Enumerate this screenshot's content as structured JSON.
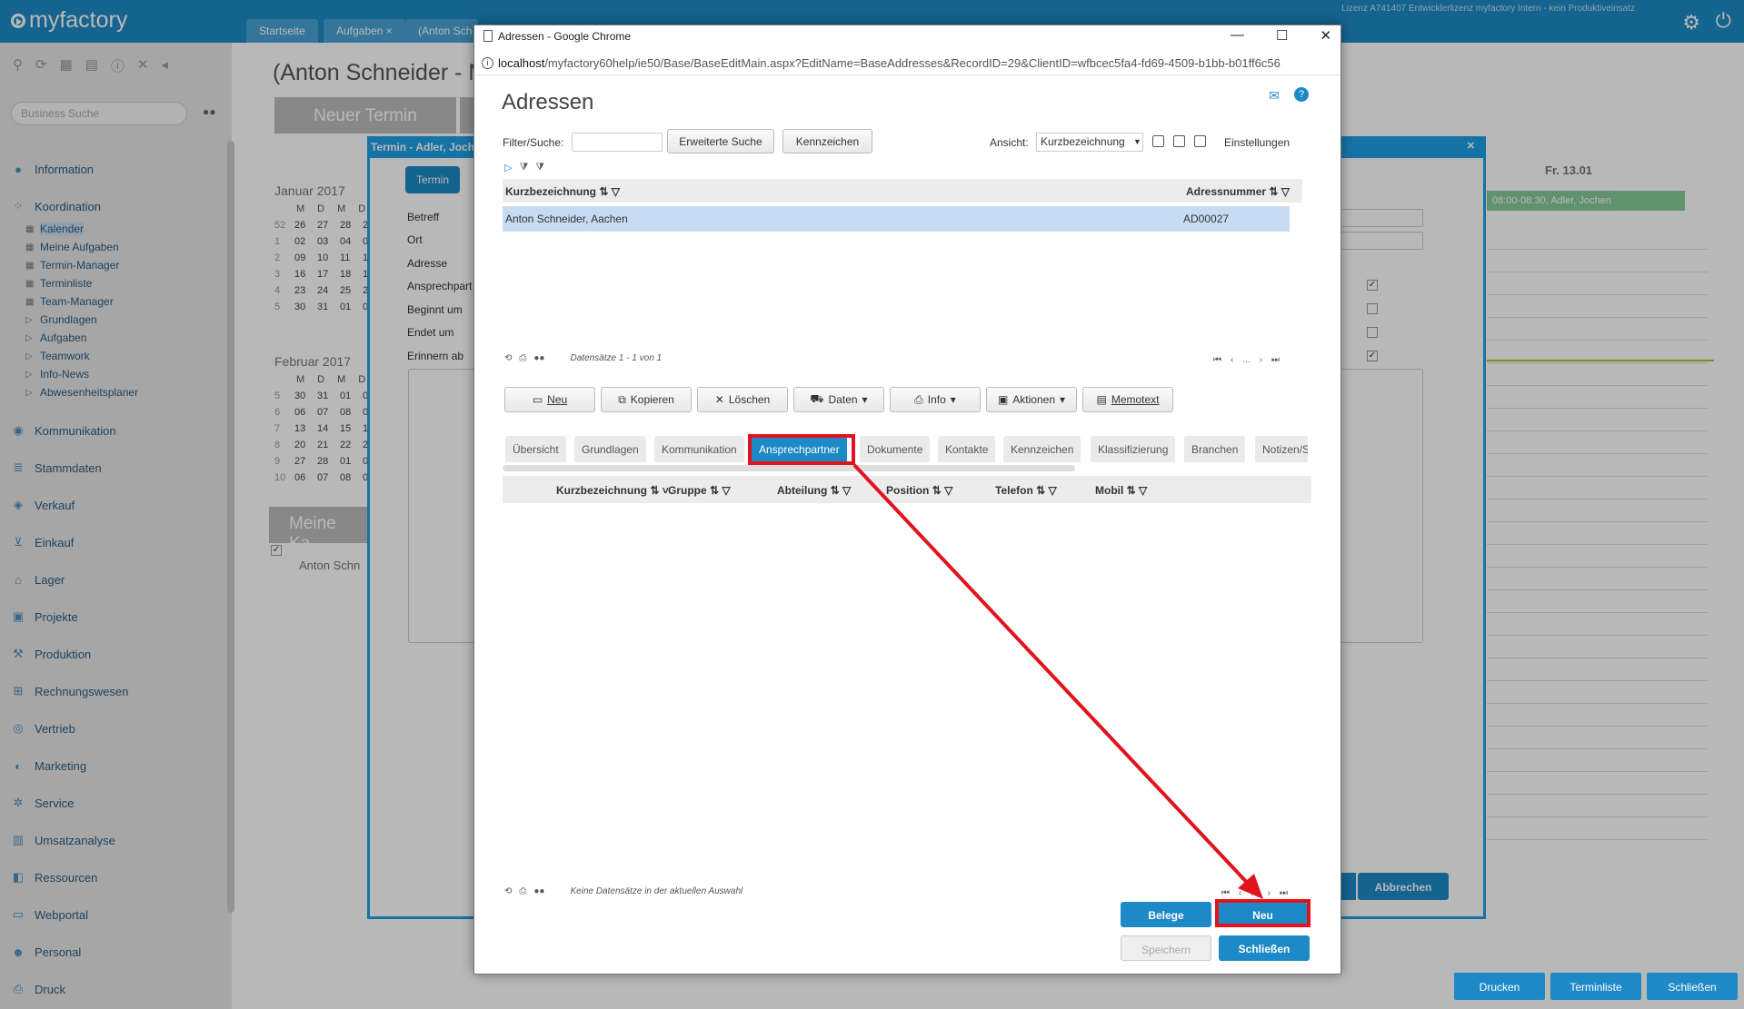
{
  "app": {
    "logo": "myfactory",
    "license": "Lizenz A741407 Entwicklerlizenz myfactory Intern - kein Produktiveinsatz",
    "tabs": [
      "Startseite",
      "Aufgaben",
      "(Anton Sch"
    ],
    "tab_close": "×"
  },
  "sidebar": {
    "search_placeholder": "Business Suche",
    "items": [
      {
        "label": "Information",
        "icon": "info-icon"
      },
      {
        "label": "Koordination",
        "icon": "coordination-icon"
      },
      {
        "label": "Kommunikation",
        "icon": "chat-icon"
      },
      {
        "label": "Stammdaten",
        "icon": "database-icon"
      },
      {
        "label": "Verkauf",
        "icon": "sale-icon"
      },
      {
        "label": "Einkauf",
        "icon": "cart-icon"
      },
      {
        "label": "Lager",
        "icon": "warehouse-icon"
      },
      {
        "label": "Projekte",
        "icon": "project-icon"
      },
      {
        "label": "Produktion",
        "icon": "production-icon"
      },
      {
        "label": "Rechnungswesen",
        "icon": "accounting-icon"
      },
      {
        "label": "Vertrieb",
        "icon": "distribution-icon"
      },
      {
        "label": "Marketing",
        "icon": "marketing-icon"
      },
      {
        "label": "Service",
        "icon": "service-icon"
      },
      {
        "label": "Umsatzanalyse",
        "icon": "chart-icon"
      },
      {
        "label": "Ressourcen",
        "icon": "resource-icon"
      },
      {
        "label": "Webportal",
        "icon": "web-icon"
      },
      {
        "label": "Personal",
        "icon": "people-icon"
      },
      {
        "label": "Druck",
        "icon": "print-icon"
      }
    ],
    "subitems": [
      "Kalender",
      "Meine Aufgaben",
      "Termin-Manager",
      "Terminliste",
      "Team-Manager",
      "Grundlagen",
      "Aufgaben",
      "Teamwork",
      "Info-News",
      "Abwesenheitsplaner"
    ]
  },
  "background": {
    "page_title": "(Anton Schneider - M",
    "neuer_termin": "Neuer Termin",
    "january": "Januar 2017",
    "february": "Februar 2017",
    "weekdays": [
      "M",
      "D",
      "M",
      "D"
    ],
    "jan_rows": [
      [
        "52",
        "26",
        "27",
        "28",
        "2"
      ],
      [
        "1",
        "02",
        "03",
        "04",
        "0"
      ],
      [
        "2",
        "09",
        "10",
        "11",
        "1"
      ],
      [
        "3",
        "16",
        "17",
        "18",
        "1"
      ],
      [
        "4",
        "23",
        "24",
        "25",
        "2"
      ],
      [
        "5",
        "30",
        "31",
        "01",
        "0"
      ]
    ],
    "feb_rows": [
      [
        "5",
        "30",
        "31",
        "01",
        "0"
      ],
      [
        "6",
        "06",
        "07",
        "08",
        "0"
      ],
      [
        "7",
        "13",
        "14",
        "15",
        "1"
      ],
      [
        "8",
        "20",
        "21",
        "22",
        "2"
      ],
      [
        "9",
        "27",
        "28",
        "01",
        "0"
      ],
      [
        "10",
        "06",
        "07",
        "08",
        "0"
      ]
    ],
    "meine_kalender": "Meine Ka",
    "person": "Anton Schn",
    "day_header": "Fr. 13.01",
    "event": "08:00-08:30, Adler, Jochen",
    "buttons": [
      "Drucken",
      "Terminliste",
      "Schließen"
    ]
  },
  "termin_dialog": {
    "title": "Termin - Adler, Joch",
    "close": "×",
    "tab": "Termin",
    "fields": [
      "Betreff",
      "Ort",
      "Adresse",
      "Ansprechpart",
      "Beginnt um",
      "Endet um",
      "Erinnern ab"
    ],
    "abbrechen": "Abbrechen"
  },
  "chrome": {
    "title": "Adressen - Google Chrome",
    "url_host": "localhost",
    "url_path": "/myfactory60help/ie50/Base/BaseEditMain.aspx?EditName=BaseAddresses&RecordID=29&ClientID=wfbcec5fa4-fd69-4509-b1bb-b01ff6c56",
    "ctrl_min": "—",
    "ctrl_max": "☐",
    "ctrl_close": "✕"
  },
  "adressen": {
    "title": "Adressen",
    "filter_label": "Filter/Suche:",
    "filter_value": "",
    "erweiterte_suche": "Erweiterte Suche",
    "kennzeichen": "Kennzeichen",
    "ansicht_label": "Ansicht:",
    "ansicht_value": "Kurzbezeichnung",
    "einstellungen": "Einstellungen",
    "grid1_columns": [
      "Kurzbezeichnung",
      "Adressnummer"
    ],
    "grid1_rows": [
      {
        "name": "Anton Schneider, Aachen",
        "nr": "AD00027"
      }
    ],
    "grid1_status": "Datensätze 1 - 1 von 1",
    "pager_dots": "...",
    "toolbar": [
      "Neu",
      "Kopieren",
      "Löschen",
      "Daten",
      "Info",
      "Aktionen",
      "Memotext"
    ],
    "subtabs": [
      "Übersicht",
      "Grundlagen",
      "Kommunikation",
      "Ansprechpartner",
      "Dokumente",
      "Kontakte",
      "Kennzeichen",
      "Klassifizierung",
      "Branchen",
      "Notizen/S"
    ],
    "active_subtab": "Ansprechpartner",
    "grid2_columns": [
      "Kurzbezeichnung",
      "Gruppe",
      "Abteilung",
      "Position",
      "Telefon",
      "Mobil"
    ],
    "grid2_status": "Keine Datensätze in der aktuellen Auswahl",
    "belege": "Belege",
    "neu": "Neu",
    "speichern": "Speichern",
    "schliessen": "Schließen"
  },
  "colors": {
    "accent": "#1e89c7",
    "highlight": "#e0141e",
    "selection": "#c7dcf3"
  }
}
